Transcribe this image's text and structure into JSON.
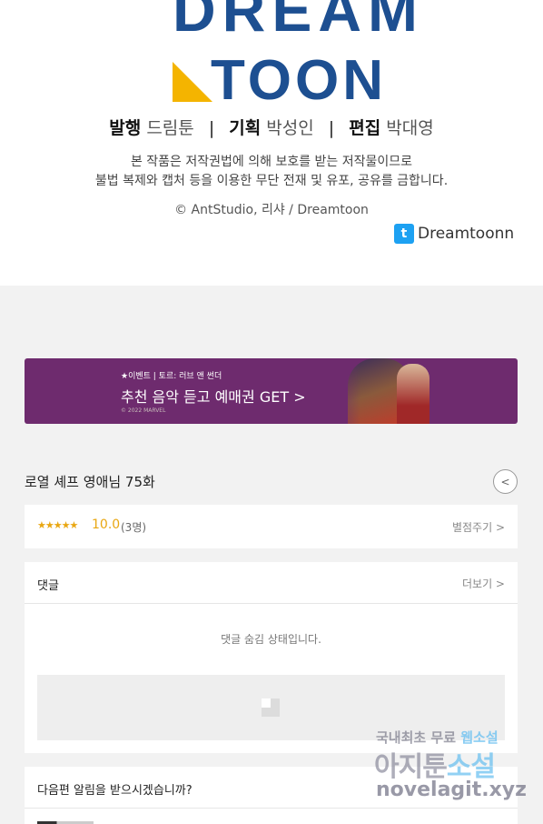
{
  "logo": {
    "line1": "DREAM",
    "line2": "TOON"
  },
  "credits": {
    "publish_label": "발행",
    "publish_value": "드림툰",
    "plan_label": "기획",
    "plan_value": "박성인",
    "edit_label": "편집",
    "edit_value": "박대영",
    "separator": "|"
  },
  "notice": {
    "line1": "본 작품은 저작권법에 의해 보호를 받는 저작물이므로",
    "line2": "불법 복제와 캡처 등을 이용한 무단 전재 및 유포, 공유를 금합니다."
  },
  "copyright": "© AntStudio, 리샤 / Dreamtoon",
  "twitter": {
    "icon": "twitter-icon",
    "handle": "Dreamtoonn"
  },
  "banner": {
    "small": "★이벤트 | 토르: 러브 앤 썬더",
    "main": "추천 음악 듣고 예매권 GET >",
    "copy": "© 2022 MARVEL"
  },
  "episode": {
    "title": "로열 셰프 영애님 75화",
    "share_icon": "share-icon"
  },
  "rating": {
    "stars": "★★★★★",
    "score": "10.0",
    "count": "(3명)",
    "rate_button": "별점주기 >"
  },
  "comments": {
    "title": "댓글",
    "more": "더보기 >",
    "hidden_message": "댓글 숨김 상태입니다."
  },
  "notify": {
    "title": "다음편 알림을 받으시겠습니까?"
  },
  "watermark": {
    "line1_a": "국내최초 무료 ",
    "line1_b": "웹소설",
    "line2_a": "아지툰",
    "line2_b": "소설",
    "line3": "novelagit.xyz"
  },
  "colors": {
    "brand_blue": "#1d4f91",
    "brand_yellow": "#f4b400",
    "star": "#e9a712",
    "banner_bg": "#6e2b6e",
    "twitter": "#1da1f2"
  }
}
